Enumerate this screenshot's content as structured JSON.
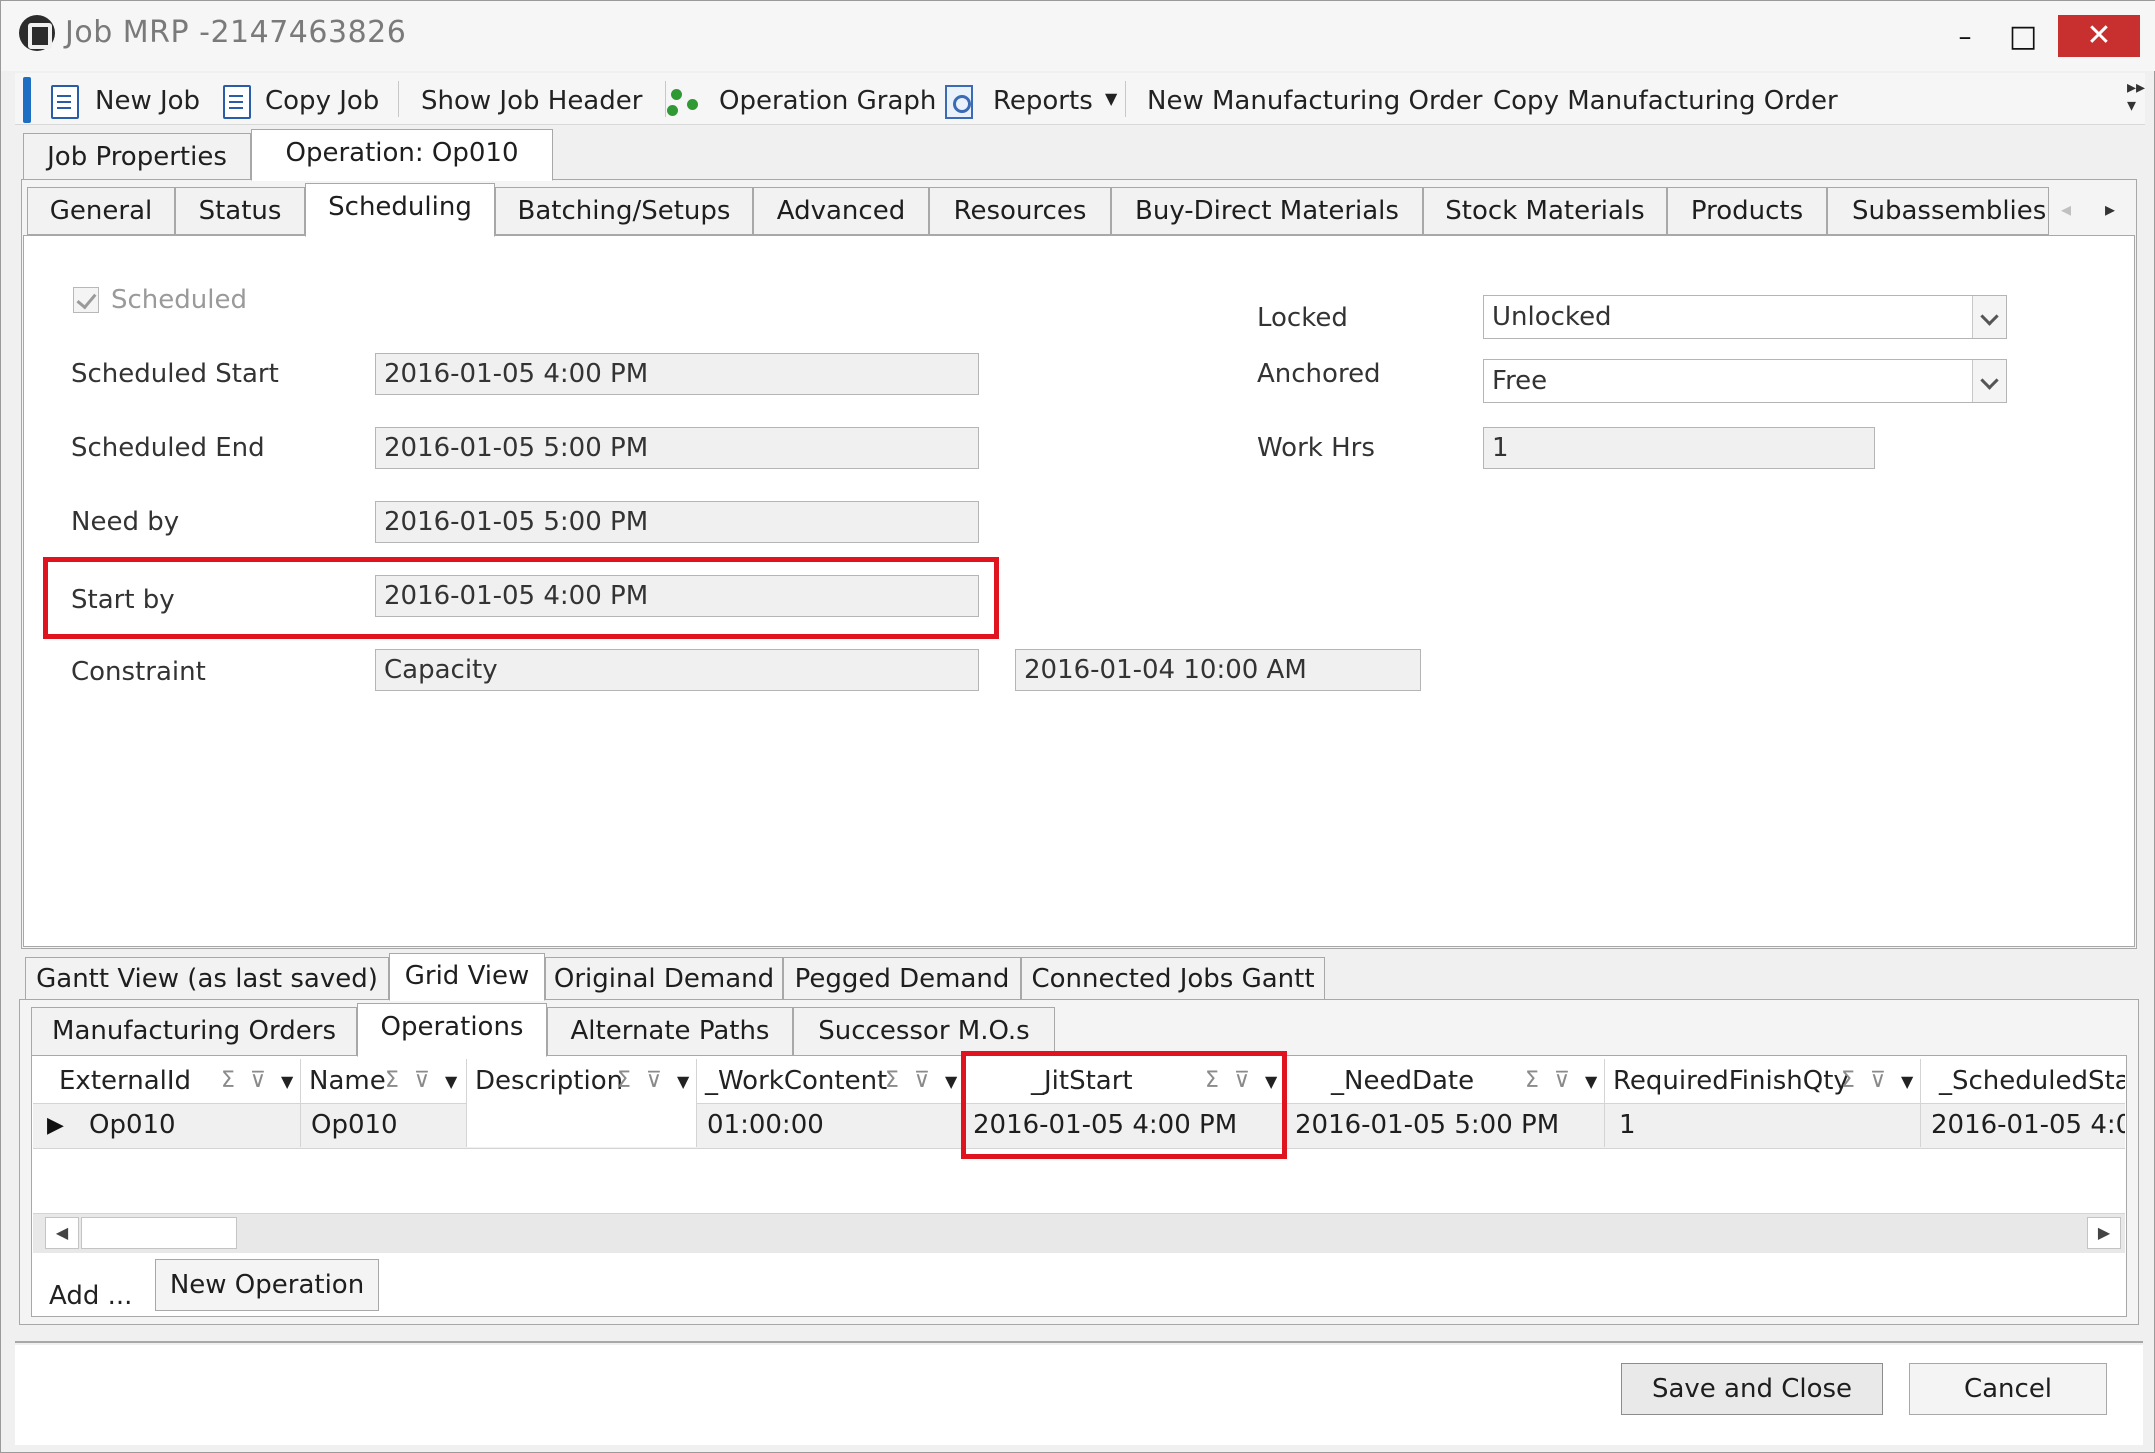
{
  "window": {
    "title": "Job MRP -2147463826",
    "minimize": "–",
    "maximize": "□",
    "close": "✕"
  },
  "toolbar": {
    "new_job": "New Job",
    "copy_job": "Copy Job",
    "show_job_header": "Show Job Header",
    "operation_graph": "Operation Graph",
    "reports": "Reports",
    "new_mo": "New Manufacturing Order",
    "copy_mo": "Copy Manufacturing Order"
  },
  "top_tabs": [
    "Job Properties",
    "Operation: Op010"
  ],
  "op_tabs": [
    "General",
    "Status",
    "Scheduling",
    "Batching/Setups",
    "Advanced",
    "Resources",
    "Buy-Direct Materials",
    "Stock Materials",
    "Products",
    "Subassemblies"
  ],
  "scheduling": {
    "scheduled_label": "Scheduled",
    "scheduled_checked": true,
    "scheduled_start_label": "Scheduled Start",
    "scheduled_start": "2016-01-05  4:00 PM",
    "scheduled_end_label": "Scheduled End",
    "scheduled_end": "2016-01-05  5:00 PM",
    "need_by_label": "Need by",
    "need_by": "2016-01-05  5:00 PM",
    "start_by_label": "Start by",
    "start_by": "2016-01-05  4:00 PM",
    "constraint_label": "Constraint",
    "constraint": "Capacity",
    "constraint_date": "2016-01-04  10:00 AM",
    "locked_label": "Locked",
    "locked": "Unlocked",
    "anchored_label": "Anchored",
    "anchored": "Free",
    "work_hrs_label": "Work Hrs",
    "work_hrs": "1"
  },
  "bottom_tabs": [
    "Gantt View (as last saved)",
    "Grid View",
    "Original Demand",
    "Pegged Demand",
    "Connected Jobs Gantt"
  ],
  "grid_tabs": [
    "Manufacturing Orders",
    "Operations",
    "Alternate Paths",
    "Successor M.O.s"
  ],
  "grid": {
    "columns": [
      "ExternalId",
      "Name",
      "Description",
      "_WorkContent",
      "_JitStart",
      "_NeedDate",
      "RequiredFinishQty",
      "_ScheduledSta"
    ],
    "header_icons": "Σ ⊽",
    "rows": [
      [
        "Op010",
        "Op010",
        "",
        "01:00:00",
        "2016-01-05 4:00 PM",
        "2016-01-05 5:00 PM",
        "1",
        "2016-01-05 4:0"
      ]
    ]
  },
  "add_label": "Add ...",
  "new_operation": "New Operation",
  "footer": {
    "save_close": "Save and Close",
    "cancel": "Cancel"
  }
}
